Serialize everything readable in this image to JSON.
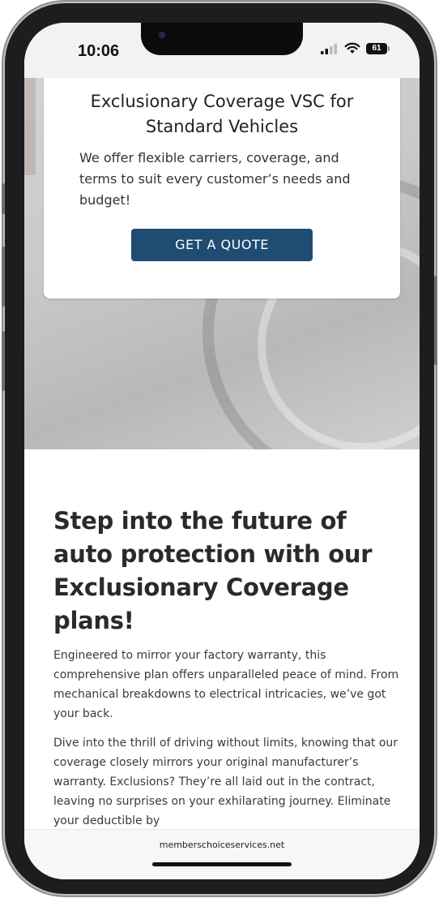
{
  "status_bar": {
    "time": "10:06",
    "battery_level": "61",
    "icons": [
      "cellular-signal-icon",
      "wifi-icon",
      "battery-icon"
    ]
  },
  "card": {
    "title": "Exclusionary Coverage VSC for Standard Vehicles",
    "body": "We offer flexible carriers, coverage, and terms to suit every customer’s needs and budget!",
    "button_label": "GET A QUOTE"
  },
  "main": {
    "headline": "Step into the future of auto protection with our Exclusionary Coverage plans!",
    "paragraph_1": "Engineered to mirror your factory warranty, this comprehensive plan offers unparalleled peace of mind. From mechanical breakdowns to electrical intricacies, we’ve got your back.",
    "paragraph_2": "Dive into the thrill of driving without limits, knowing that our coverage closely mirrors your original manufacturer’s warranty. Exclusions? They’re all laid out in the contract, leaving no surprises on your exhilarating journey. Eliminate your deductible by"
  },
  "browser": {
    "url": "memberschoiceservices.net"
  },
  "colors": {
    "button_bg": "#1f4c72",
    "button_text": "#ffffff",
    "headline": "#2a2a2a"
  }
}
